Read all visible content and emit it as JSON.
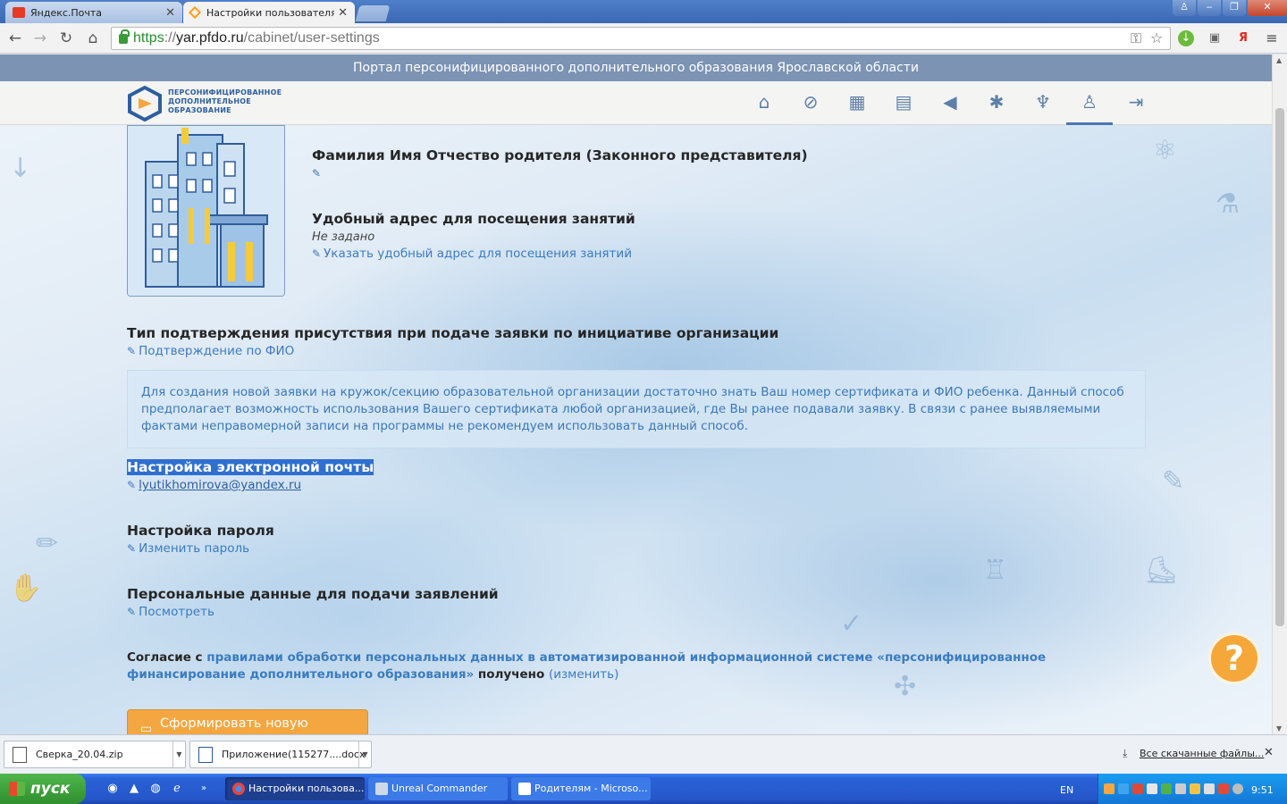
{
  "browser": {
    "tabs": [
      {
        "title": "Яндекс.Почта"
      },
      {
        "title": "Настройки пользователя |"
      }
    ],
    "url": {
      "scheme": "https",
      "sep": "://",
      "host": "yar.pfdo.ru",
      "path": "/cabinet/user-settings"
    }
  },
  "portal": {
    "band_title": "Портал персонифицированного дополнительного образования Ярославской области",
    "logo_lines": [
      "ПЕРСОНИФИЦИРОВАННОЕ",
      "ДОПОЛНИТЕЛЬНОЕ",
      "ОБРАЗОВАНИЕ"
    ],
    "nav": [
      {
        "name": "home-icon",
        "glyph": "⌂"
      },
      {
        "name": "compass-icon",
        "glyph": "⊘"
      },
      {
        "name": "calendar-icon",
        "glyph": "▦"
      },
      {
        "name": "document-icon",
        "glyph": "▤"
      },
      {
        "name": "megaphone-icon",
        "glyph": "◀"
      },
      {
        "name": "star-icon",
        "glyph": "✱"
      },
      {
        "name": "trophy-icon",
        "glyph": "♆"
      },
      {
        "name": "user-icon",
        "glyph": "♙"
      },
      {
        "name": "logout-icon",
        "glyph": "⇥"
      }
    ]
  },
  "settings": {
    "parent_name_heading": "Фамилия Имя Отчество родителя (Законного представителя)",
    "address_heading": "Удобный адрес для посещения занятий",
    "address_value": "Не задано",
    "address_link": "Указать удобный адрес для посещения занятий",
    "confirm_heading": "Тип подтверждения присутствия при подаче заявки по инициативе организации",
    "confirm_link": "Подтверждение по ФИО",
    "confirm_info": "Для создания новой заявки на кружок/секцию образовательной организации достаточно знать Ваш номер сертификата и ФИО ребенка. Данный способ предполагает возможность использования Вашего сертификата любой организацией, где Вы ранее подавали заявку. В связи с ранее выявляемыми фактами неправомерной записи на программы не рекомендуем использовать данный способ.",
    "email_heading": "Настройка электронной почты",
    "email_value": "lyutikhomirova@yandex.ru",
    "password_heading": "Настройка пароля",
    "password_link": "Изменить пароль",
    "personal_heading": "Персональные данные для подачи заявлений",
    "personal_link": "Посмотреть",
    "consent_prefix": "Согласие с ",
    "consent_rules": "правилами обработки персональных данных в автоматизированной информационной системе «персонифицированное финансирование дополнительного образования»",
    "consent_received": " получено ",
    "consent_change": "(изменить)",
    "new_statement_button": "Сформировать новую выписку",
    "help_glyph": "?"
  },
  "downloads": {
    "items": [
      {
        "name": "Сверка_20.04.zip"
      },
      {
        "name": "Приложение(115277....docx"
      }
    ],
    "all_link": "Все скачанные файлы..."
  },
  "taskbar": {
    "start_label": "пуск",
    "tasks": [
      {
        "label": "Настройки пользова..."
      },
      {
        "label": "Unreal Commander"
      },
      {
        "label": "Родителям - Microso..."
      }
    ],
    "lang": "EN",
    "clock": "9:51"
  },
  "colors": {
    "accent": "#3b7cc0",
    "orange": "#f4a640",
    "band": "#7c93b3",
    "highlight": "#2f6fd1"
  }
}
